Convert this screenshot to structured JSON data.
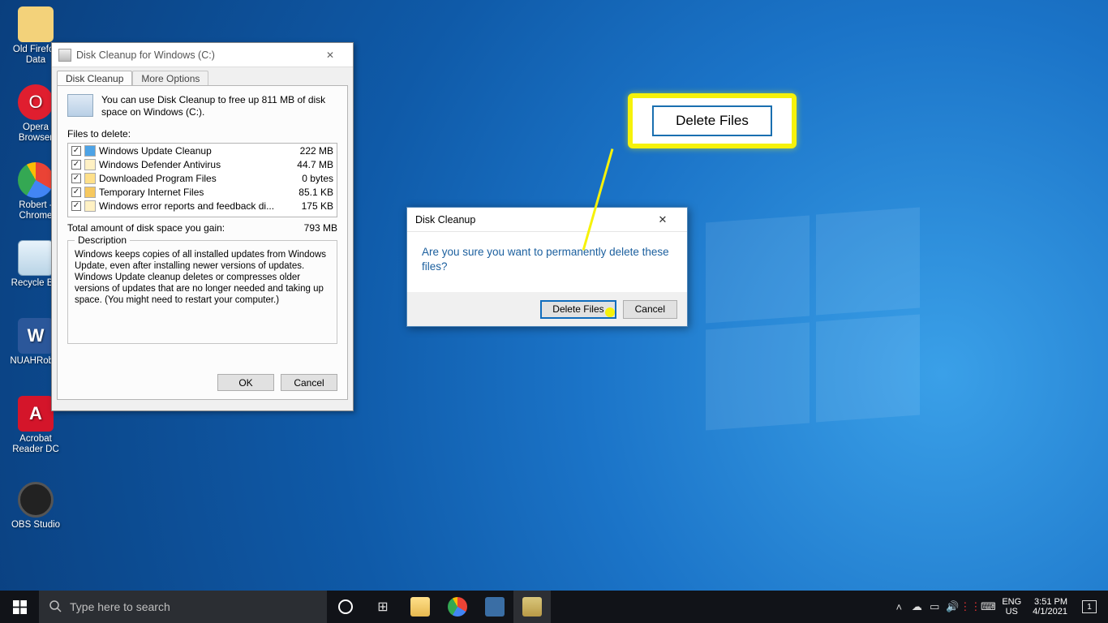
{
  "desktop": {
    "icons": [
      {
        "label": "Old Firefox Data",
        "color": "#f3d27a"
      },
      {
        "label": "Opera Browser",
        "color": "#e01e2f"
      },
      {
        "label": "Robert - Chrome",
        "color": "#2aa147"
      },
      {
        "label": "Recycle Bin",
        "color": "#cfe6f5"
      },
      {
        "label": "NUAHRob...",
        "color": "#2b579a"
      },
      {
        "label": "Acrobat Reader DC",
        "color": "#d4152a"
      },
      {
        "label": "OBS Studio",
        "color": "#222222"
      }
    ]
  },
  "diskCleanup": {
    "title": "Disk Cleanup for Windows (C:)",
    "tabs": {
      "active": "Disk Cleanup",
      "second": "More Options"
    },
    "freeupText": "You can use Disk Cleanup to free up 811 MB of disk space on Windows (C:).",
    "filesToDeleteLabel": "Files to delete:",
    "items": [
      {
        "name": "Windows Update Cleanup",
        "size": "222 MB",
        "checked": true
      },
      {
        "name": "Windows Defender Antivirus",
        "size": "44.7 MB",
        "checked": true
      },
      {
        "name": "Downloaded Program Files",
        "size": "0 bytes",
        "checked": true
      },
      {
        "name": "Temporary Internet Files",
        "size": "85.1 KB",
        "checked": true
      },
      {
        "name": "Windows error reports and feedback di...",
        "size": "175 KB",
        "checked": true
      }
    ],
    "totalLabel": "Total amount of disk space you gain:",
    "totalValue": "793 MB",
    "descLegend": "Description",
    "descText": "Windows keeps copies of all installed updates from Windows Update, even after installing newer versions of updates. Windows Update cleanup deletes or compresses older versions of updates that are no longer needed and taking up space. (You might need to restart your computer.)",
    "okLabel": "OK",
    "cancelLabel": "Cancel"
  },
  "confirm": {
    "title": "Disk Cleanup",
    "message": "Are you sure you want to permanently delete these files?",
    "deleteLabel": "Delete Files",
    "cancelLabel": "Cancel"
  },
  "callout": {
    "buttonLabel": "Delete Files"
  },
  "taskbar": {
    "searchPlaceholder": "Type here to search",
    "lang1": "ENG",
    "lang2": "US",
    "time": "3:51 PM",
    "date": "4/1/2021",
    "notifCount": "1"
  }
}
